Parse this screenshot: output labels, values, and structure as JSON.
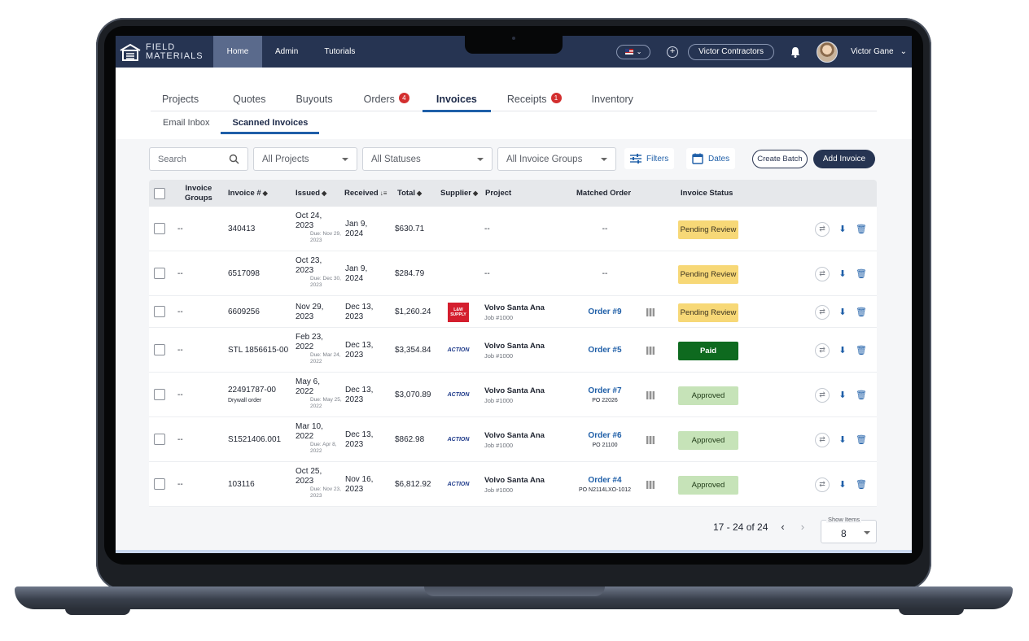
{
  "brand": {
    "line1": "FIELD",
    "line2": "MATERIALS"
  },
  "topnav": {
    "items": [
      {
        "label": "Home",
        "active": true
      },
      {
        "label": "Admin"
      },
      {
        "label": "Tutorials"
      }
    ]
  },
  "user": {
    "company": "Victor Contractors",
    "name": "Victor Gane"
  },
  "main_tabs": [
    {
      "label": "Projects"
    },
    {
      "label": "Quotes"
    },
    {
      "label": "Buyouts"
    },
    {
      "label": "Orders",
      "badge": "4"
    },
    {
      "label": "Invoices",
      "active": true
    },
    {
      "label": "Receipts",
      "badge": "1"
    },
    {
      "label": "Inventory"
    }
  ],
  "sub_tabs": [
    {
      "label": "Email Inbox"
    },
    {
      "label": "Scanned Invoices",
      "active": true
    }
  ],
  "toolbar": {
    "search_placeholder": "Search",
    "projects": "All Projects",
    "statuses": "All Statuses",
    "groups": "All Invoice Groups",
    "filters": "Filters",
    "dates": "Dates",
    "create_batch": "Create Batch",
    "add_invoice": "Add Invoice"
  },
  "table": {
    "headers": {
      "groups_1": "Invoice",
      "groups_2": "Groups",
      "invoice": "Invoice #",
      "issued": "Issued",
      "received": "Received",
      "total": "Total",
      "supplier": "Supplier",
      "project": "Project",
      "matched": "Matched Order",
      "status": "Invoice Status"
    },
    "rows": [
      {
        "group": "--",
        "invoice": "340413",
        "invoice_note": "",
        "issued_1": "Oct 24,",
        "issued_2": "2023",
        "due_1": "Due: Nov 29,",
        "due_2": "2023",
        "received_1": "Jan 9,",
        "received_2": "2024",
        "total": "$630.71",
        "supplier": "",
        "project": "--",
        "job": "",
        "order": "--",
        "po": "",
        "status": "Pending Review",
        "status_type": "pending"
      },
      {
        "group": "--",
        "invoice": "6517098",
        "invoice_note": "",
        "issued_1": "Oct 23,",
        "issued_2": "2023",
        "due_1": "Due: Dec 30,",
        "due_2": "2023",
        "received_1": "Jan 9,",
        "received_2": "2024",
        "total": "$284.79",
        "supplier": "",
        "project": "--",
        "job": "",
        "order": "--",
        "po": "",
        "status": "Pending Review",
        "status_type": "pending"
      },
      {
        "group": "--",
        "invoice": "6609256",
        "invoice_note": "",
        "issued_1": "Nov 29,",
        "issued_2": "2023",
        "due_1": "",
        "due_2": "",
        "received_1": "Dec 13,",
        "received_2": "2023",
        "total": "$1,260.24",
        "supplier": "L&W SUPPLY",
        "project": "Volvo Santa Ana",
        "job": "Job #1000",
        "order": "Order #9",
        "po": "",
        "status": "Pending Review",
        "status_type": "pending"
      },
      {
        "group": "--",
        "invoice": "STL 1856615-00",
        "invoice_note": "",
        "issued_1": "Feb 23,",
        "issued_2": "2022",
        "due_1": "Due: Mar 24,",
        "due_2": "2022",
        "received_1": "Dec 13,",
        "received_2": "2023",
        "total": "$3,354.84",
        "supplier": "ACTION",
        "project": "Volvo Santa Ana",
        "job": "Job #1000",
        "order": "Order #5",
        "po": "",
        "status": "Paid",
        "status_type": "paid"
      },
      {
        "group": "--",
        "invoice": "22491787-00",
        "invoice_note": "Drywall order",
        "issued_1": "May 6,",
        "issued_2": "2022",
        "due_1": "Due: May 25,",
        "due_2": "2022",
        "received_1": "Dec 13,",
        "received_2": "2023",
        "total": "$3,070.89",
        "supplier": "ACTION",
        "project": "Volvo Santa Ana",
        "job": "Job #1000",
        "order": "Order #7",
        "po": "PO 22026",
        "status": "Approved",
        "status_type": "approved"
      },
      {
        "group": "--",
        "invoice": "S1521406.001",
        "invoice_note": "",
        "issued_1": "Mar 10,",
        "issued_2": "2022",
        "due_1": "Due: Apr 8,",
        "due_2": "2022",
        "received_1": "Dec 13,",
        "received_2": "2023",
        "total": "$862.98",
        "supplier": "ACTION",
        "project": "Volvo Santa Ana",
        "job": "Job #1000",
        "order": "Order #6",
        "po": "PO 21100",
        "status": "Approved",
        "status_type": "approved"
      },
      {
        "group": "--",
        "invoice": "103116",
        "invoice_note": "",
        "issued_1": "Oct 25,",
        "issued_2": "2023",
        "due_1": "Due: Nov 23,",
        "due_2": "2023",
        "received_1": "Nov 16,",
        "received_2": "2023",
        "total": "$6,812.92",
        "supplier": "ACTION",
        "project": "Volvo Santa Ana",
        "job": "Job #1000",
        "order": "Order #4",
        "po": "PO N2114LXO-1012",
        "status": "Approved",
        "status_type": "approved"
      }
    ]
  },
  "pagination": {
    "range": "17 - 24 of 24",
    "show_label": "Show Items",
    "show_value": "8"
  },
  "colors": {
    "navbar": "#263452",
    "accent": "#1f5fa8",
    "pending": "#f7d877",
    "paid": "#0e6a1f",
    "approved": "#c6e3b8",
    "badge": "#d32f2f"
  }
}
